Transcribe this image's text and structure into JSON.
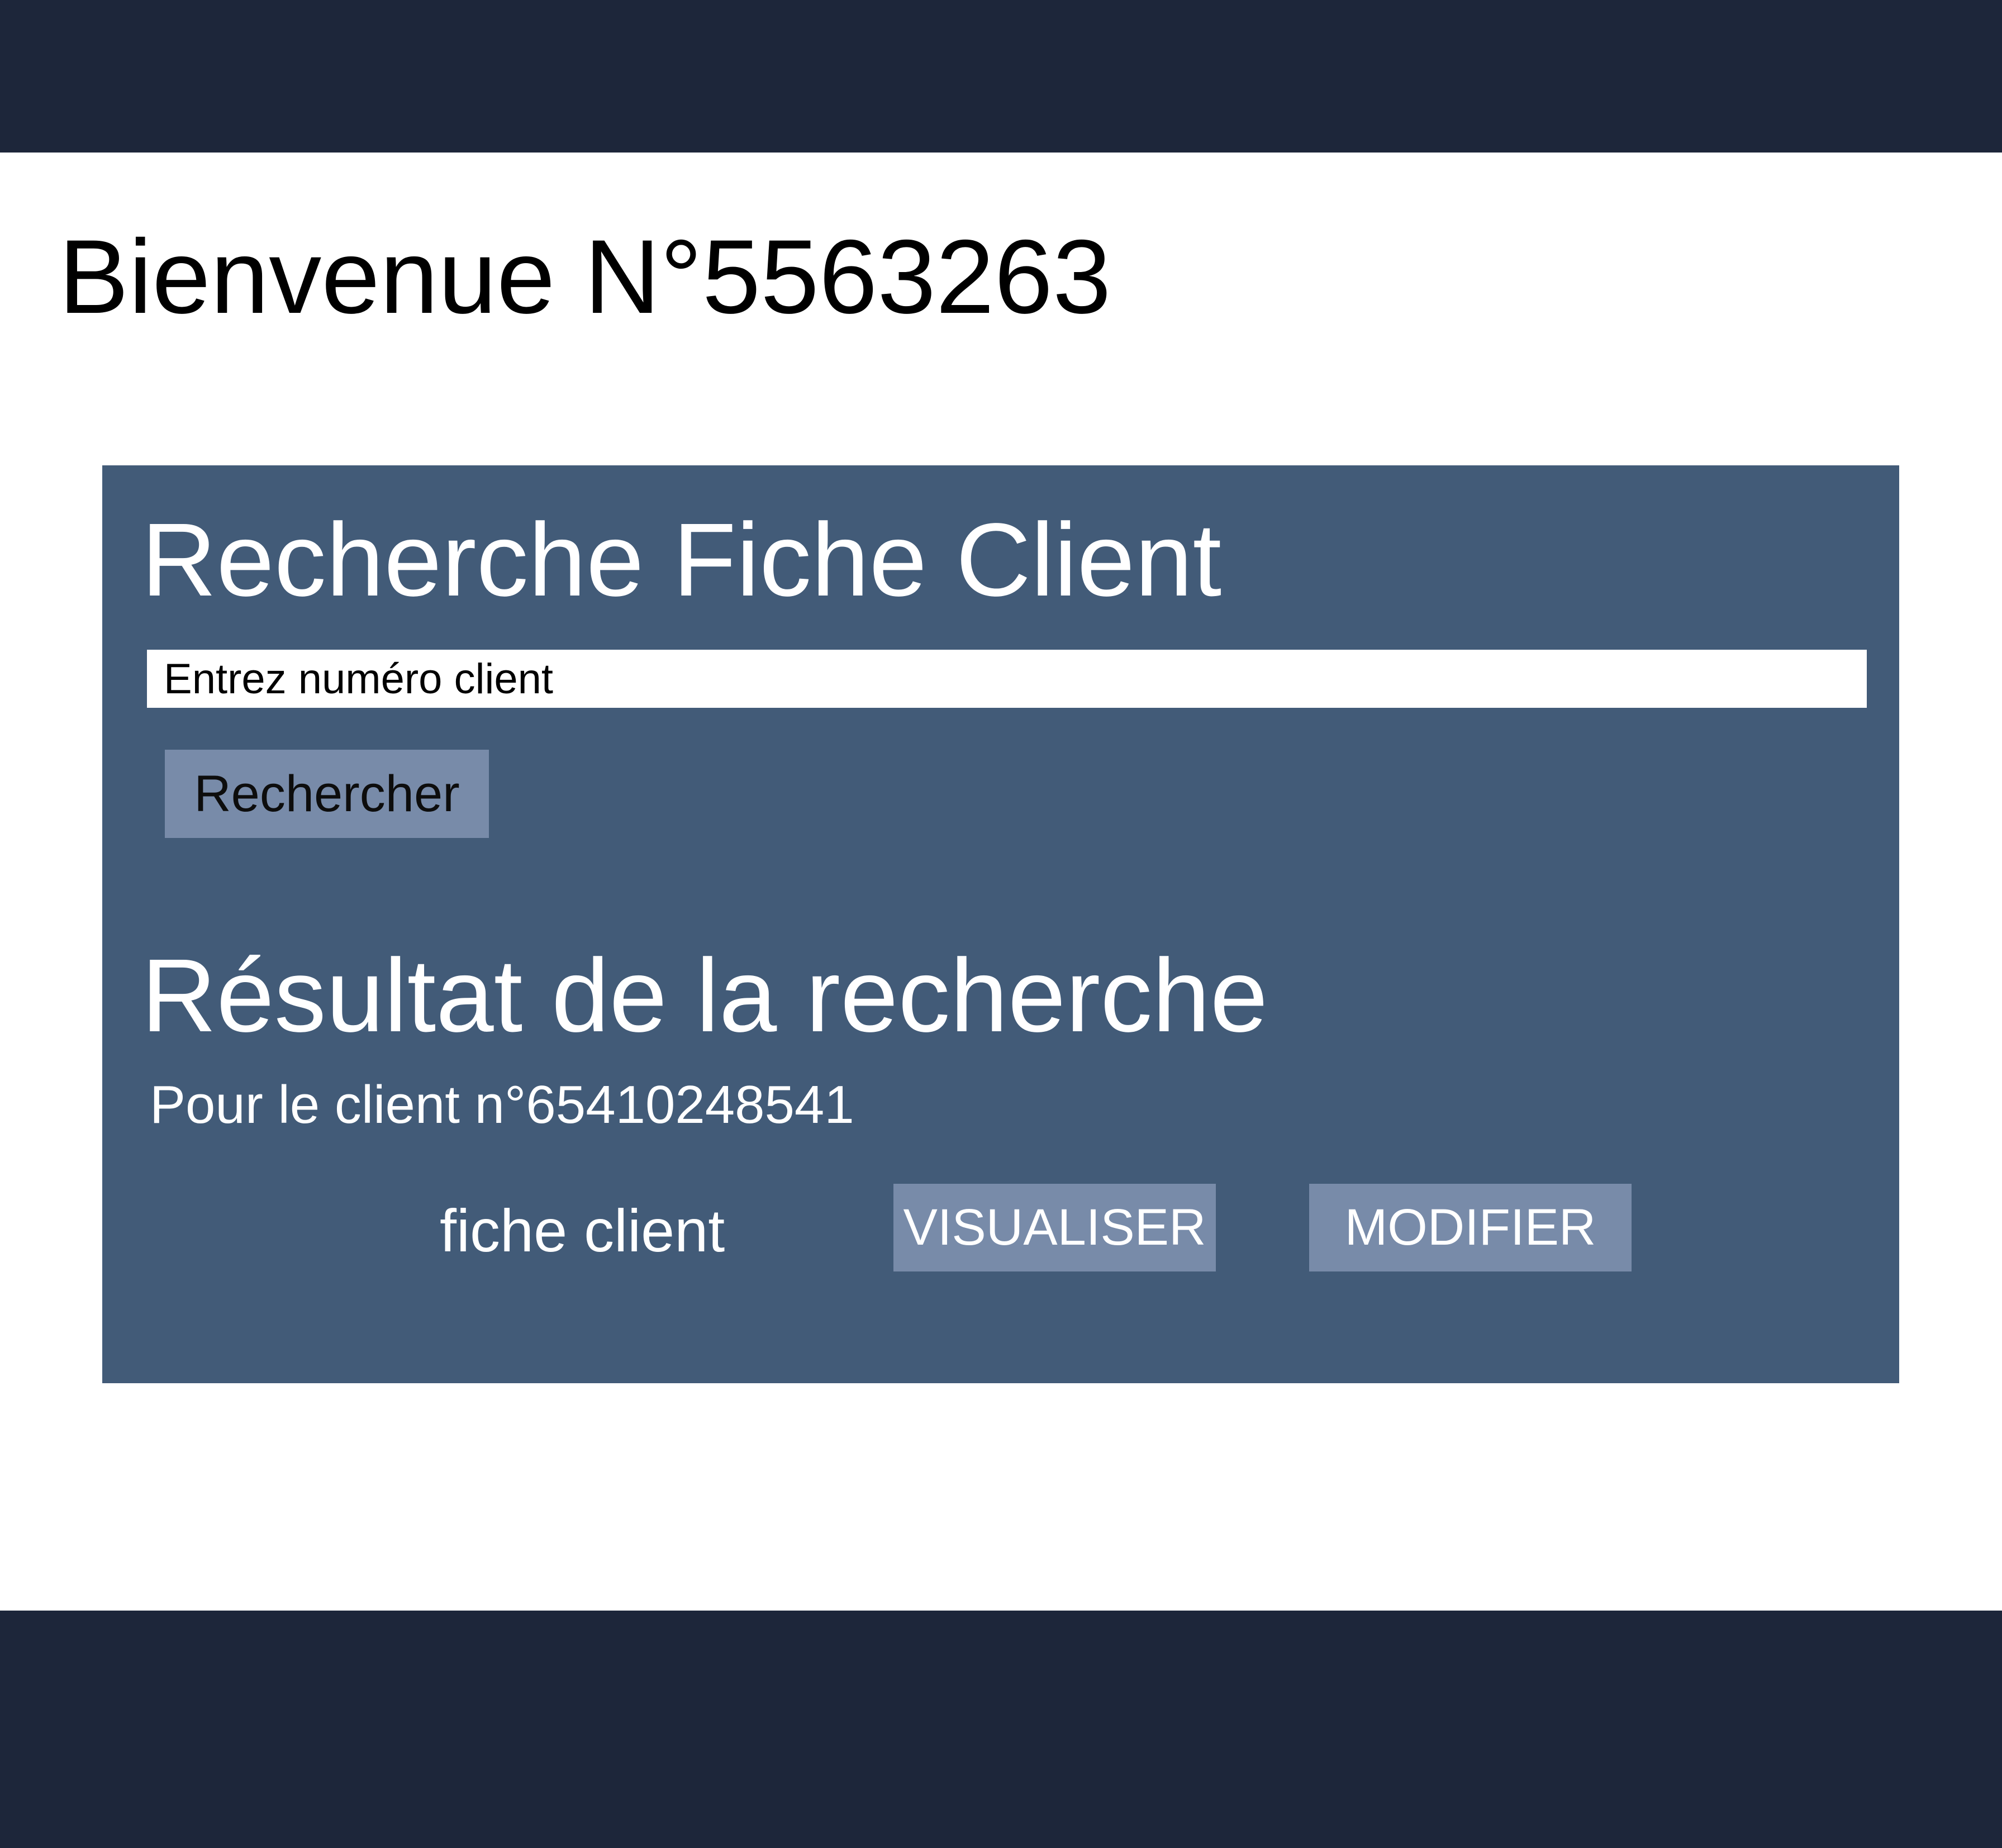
{
  "header": {
    "welcome": "Bienvenue N°5563263"
  },
  "search": {
    "title": "Recherche Fiche Client",
    "placeholder": "Entrez numéro client",
    "button_label": "Rechercher"
  },
  "results": {
    "title": "Résultat de la recherche",
    "client_line": "Pour le client n°65410248541",
    "record_label": "fiche client",
    "view_label": "VISUALISER",
    "edit_label": "MODIFIER"
  },
  "colors": {
    "bar": "#1d263a",
    "panel": "#425b78",
    "button": "#788ba9"
  }
}
